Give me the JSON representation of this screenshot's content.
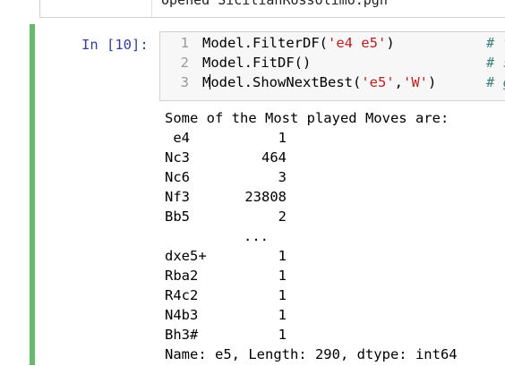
{
  "previous_cell": {
    "output_text": "Opened SicilianRossolimo.pgn"
  },
  "cell": {
    "prompt": "In [10]:",
    "accent_color": "#66bb6a",
    "code_lines": [
      {
        "number": "1",
        "parts": [
          {
            "t": "Model.FilterDF("
          },
          {
            "t": "'e4 e5'",
            "s": true
          },
          {
            "t": ")"
          }
        ],
        "comment": "# f"
      },
      {
        "number": "2",
        "parts": [
          {
            "t": "Model.FitDF()"
          }
        ],
        "comment": "# s"
      },
      {
        "number": "3",
        "parts": [
          {
            "t": "M"
          },
          {
            "cursor": true
          },
          {
            "t": "odel.ShowNextBest("
          },
          {
            "t": "'e5'",
            "s": true
          },
          {
            "t": ","
          },
          {
            "t": "'W'",
            "s": true
          },
          {
            "t": ")"
          }
        ],
        "comment": "# g"
      }
    ],
    "output": {
      "header": "Some of the Most played Moves are:",
      "rows_top": [
        {
          "move": " e4",
          "count": "1"
        },
        {
          "move": "Nc3",
          "count": "464"
        },
        {
          "move": "Nc6",
          "count": "3"
        },
        {
          "move": "Nf3",
          "count": "23808"
        },
        {
          "move": "Bb5",
          "count": "2"
        }
      ],
      "ellipsis": "...",
      "rows_bottom": [
        {
          "move": "dxe5+",
          "count": "1"
        },
        {
          "move": "Rba2",
          "count": "1"
        },
        {
          "move": "R4c2",
          "count": "1"
        },
        {
          "move": "N4b3",
          "count": "1"
        },
        {
          "move": "Bh3#",
          "count": "1"
        }
      ],
      "footer": "Name: e5, Length: 290, dtype: int64"
    }
  }
}
